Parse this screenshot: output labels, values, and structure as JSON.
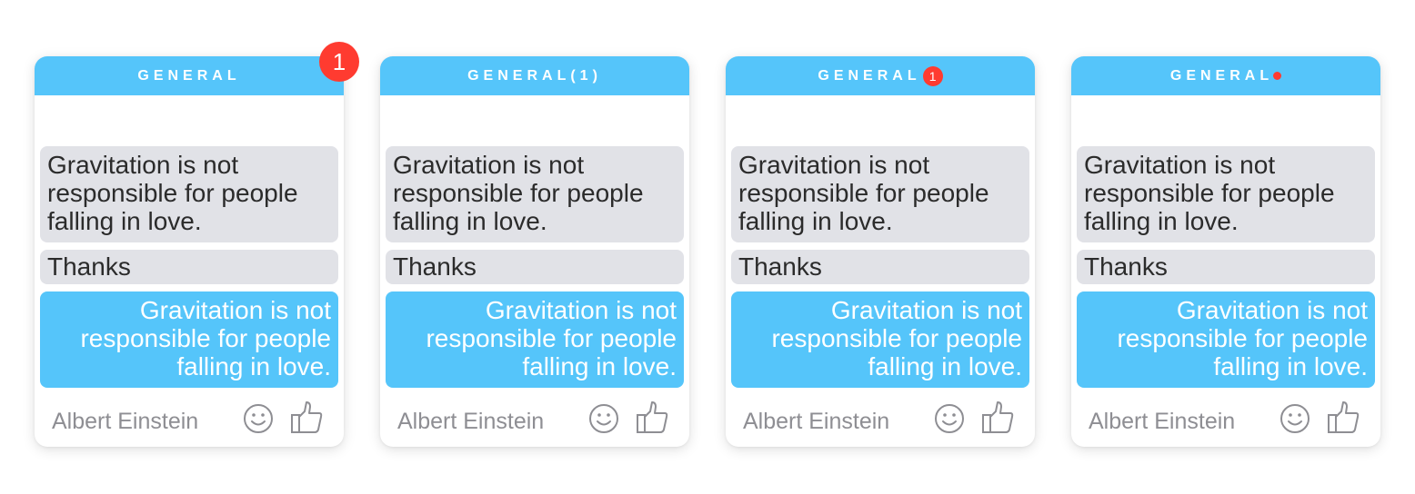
{
  "cards": [
    {
      "header": "GENERAL",
      "badge_corner": "1",
      "messages": [
        "Gravitation is not responsible for people falling in love.",
        "Thanks",
        "Gravitation is not responsible for people falling in love."
      ],
      "author": "Albert Einstein",
      "icons": [
        "smile-icon",
        "thumbs-up-icon"
      ]
    },
    {
      "header": "GENERAL(1)",
      "messages": [
        "Gravitation is not responsible for people falling in love.",
        "Thanks",
        "Gravitation is not responsible for people falling in love."
      ],
      "author": "Albert Einstein",
      "icons": [
        "smile-icon",
        "thumbs-up-icon"
      ]
    },
    {
      "header": "GENERAL",
      "badge_inline": "1",
      "messages": [
        "Gravitation is not responsible for people falling in love.",
        "Thanks",
        "Gravitation is not responsible for people falling in love."
      ],
      "author": "Albert Einstein",
      "icons": [
        "smile-icon",
        "thumbs-up-icon"
      ]
    },
    {
      "header": "GENERAL",
      "dot_indicator": true,
      "messages": [
        "Gravitation is not responsible for people falling in love.",
        "Thanks",
        "Gravitation is not responsible for people falling in love."
      ],
      "author": "Albert Einstein",
      "icons": [
        "smile-icon",
        "thumbs-up-icon"
      ]
    }
  ],
  "colors": {
    "header": "#55c5fa",
    "incoming_bubble": "#e1e2e7",
    "outgoing_bubble": "#55c5fa",
    "badge": "#ff3b30",
    "author_text": "#8e8e93"
  }
}
